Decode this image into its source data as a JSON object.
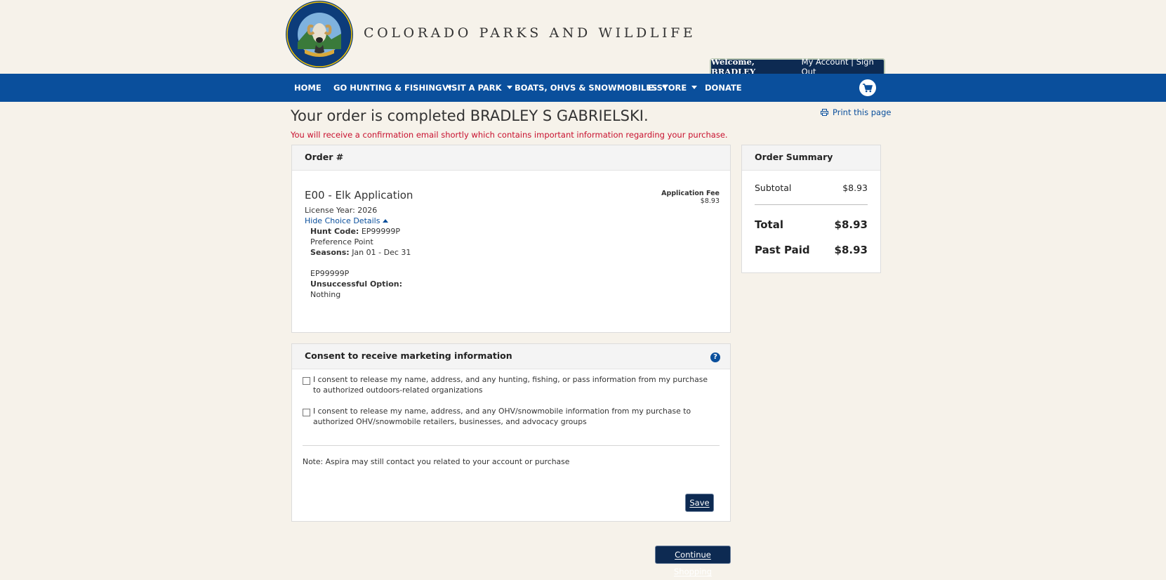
{
  "header": {
    "brand": "COLORADO PARKS AND WILDLIFE",
    "logo_text": "COLORADO PARKS & WILDLIFE",
    "welcome": "Welcome, BRADLEY",
    "my_account": "My Account",
    "separator": "|",
    "sign_out": "Sign Out"
  },
  "nav": {
    "items": [
      {
        "label": "HOME",
        "dropdown": false
      },
      {
        "label": "GO HUNTING & FISHING",
        "dropdown": true
      },
      {
        "label": "VISIT A PARK",
        "dropdown": true
      },
      {
        "label": "BOATS, OHVS & SNOWMOBILES",
        "dropdown": true
      },
      {
        "label": "E-STORE",
        "dropdown": true
      },
      {
        "label": "DONATE",
        "dropdown": false
      }
    ],
    "cart_icon": "cart-icon"
  },
  "page": {
    "title": "Your order is completed BRADLEY S GABRIELSKI.",
    "print_label": "Print this page",
    "notice": "You will receive a confirmation email shortly which contains important information regarding your purchase."
  },
  "order": {
    "header": "Order #",
    "item_title": "E00 - Elk Application",
    "license_year": "License Year: 2026",
    "hide_details": "Hide Choice Details",
    "fee_label": "Application Fee",
    "fee_value": "$8.93",
    "hunt_code_label": "Hunt Code:",
    "hunt_code_value": "EP99999P",
    "preference": "Preference Point",
    "seasons_label": "Seasons:",
    "seasons_value": "Jan 01 - Dec 31",
    "code_repeat": "EP99999P",
    "unsuccessful_label": "Unsuccessful Option:",
    "unsuccessful_value": "Nothing"
  },
  "consent": {
    "header": "Consent to receive marketing information",
    "help_icon": "?",
    "option1": "I consent to release my name, address, and any hunting, fishing, or pass information from my purchase to authorized outdoors-related organizations",
    "option2": "I consent to release my name, address, and any OHV/snowmobile information from my purchase to authorized OHV/snowmobile retailers, businesses, and advocacy groups",
    "note": "Note: Aspira may still contact you related to your account or purchase",
    "save": "Save"
  },
  "summary": {
    "header": "Order Summary",
    "subtotal_label": "Subtotal",
    "subtotal_value": "$8.93",
    "total_label": "Total",
    "total_value": "$8.93",
    "paid_label": "Past Paid",
    "paid_value": "$8.93"
  },
  "continue_label": "Continue Shopping",
  "colors": {
    "nav_blue": "#0a4f9c",
    "navy": "#0d2a52",
    "notice_red": "#c8102e",
    "background": "#f6f2ea"
  }
}
